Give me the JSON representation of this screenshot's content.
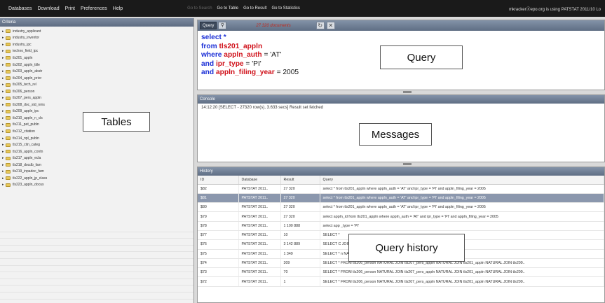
{
  "menu": {
    "left": [
      "Databases",
      "Download",
      "Print",
      "Preferences",
      "Help"
    ],
    "middle": [
      {
        "label": "Go to Search",
        "dim": true
      },
      {
        "label": "Go to Table",
        "dim": false
      },
      {
        "label": "Go to Result",
        "dim": false
      },
      {
        "label": "Go to Statistics",
        "dim": false
      }
    ],
    "user_status": "mkrackerⓐepo.org  is using  PATSTAT 2011/10  Lo"
  },
  "criteria": {
    "title": "Criteria",
    "tables": [
      "industry_applicant",
      "industry_inventor",
      "industry_ipc",
      "techno_field_ipc",
      "tls201_appln",
      "tls202_appln_title",
      "tls203_appln_abstr",
      "tls204_appln_prior",
      "tls205_tech_rel",
      "tls206_person",
      "tls207_pers_appln",
      "tls208_doc_std_nms",
      "tls209_appln_ipc",
      "tls210_appln_n_cls",
      "tls211_pat_publn",
      "tls212_citation",
      "tls214_npl_publn",
      "tls215_citn_categ",
      "tls216_appln_contn",
      "tls217_appln_ecla",
      "tls218_docdb_fam",
      "tls219_inpadoc_fam",
      "tls222_appln_jp_class",
      "tls223_appln_docus"
    ]
  },
  "query": {
    "button_label": "Query",
    "doc_count": "27 320 documents",
    "sql": {
      "l1_kw": "select *",
      "l2_kw": "from ",
      "l2_id": "tls201_appln",
      "l3_kw": "where ",
      "l3_id": "appln_auth",
      "l3_val": " = 'AT'",
      "l4_kw": "and ",
      "l4_id": "ipr_type",
      "l4_val": " = 'PI'",
      "l5_kw": "and ",
      "l5_id": "appln_filing_year",
      "l5_val": " = 2005"
    }
  },
  "console": {
    "title": "Console",
    "line": "14:12:20 [SELECT - 27320 row(s), 3.633 secs] Result set fetched"
  },
  "history": {
    "title": "History",
    "columns": [
      "ID",
      "Database",
      "Result",
      "Query"
    ],
    "rows": [
      {
        "id": "$82",
        "db": "PATSTAT 2011..",
        "result": "27 320",
        "query": "select * from tls201_appln where appln_auth = 'AT' and ipr_type = 'PI' and appln_filing_year = 2005",
        "selected": false
      },
      {
        "id": "$81",
        "db": "PATSTAT 2011..",
        "result": "27 320",
        "query": "select * from tls201_appln where appln_auth = 'AT' and ipr_type = 'PI' and appln_filing_year = 2005",
        "selected": true
      },
      {
        "id": "$80",
        "db": "PATSTAT 2011..",
        "result": "27 320",
        "query": "select * from tls201_appln where appln_auth = 'AT' and ipr_type = 'PI' and appln_filing_year = 2005",
        "selected": false
      },
      {
        "id": "$79",
        "db": "PATSTAT 2011..",
        "result": "27 320",
        "query": "select appln_id from tls201_appln where appln_auth = 'AT' and ipr_type = 'PI' and appln_filing_year = 2005",
        "selected": false
      },
      {
        "id": "$78",
        "db": "PATSTAT 2011..",
        "result": "1 100 888",
        "query": "select app                                              _type = 'PI'",
        "selected": false
      },
      {
        "id": "$77",
        "db": "PATSTAT 2011..",
        "result": "10",
        "query": "SELECT *",
        "selected": false
      },
      {
        "id": "$76",
        "db": "PATSTAT 2011..",
        "result": "3 142 889",
        "query": "SELECT C                                              JOIN tls206_person WHERE person_ctry_code = 'JP';",
        "selected": false
      },
      {
        "id": "$75",
        "db": "PATSTAT 2011..",
        "result": "1 349",
        "query": "SELECT *                                              n NATURAL JOIN tls201_appln NATURAL JOIN tls209..",
        "selected": false
      },
      {
        "id": "$74",
        "db": "PATSTAT 2011..",
        "result": "309",
        "query": "SELECT * FROM tls206_person NATURAL JOIN tls207_pers_appln NATURAL JOIN tls201_appln NATURAL JOIN tls209..",
        "selected": false
      },
      {
        "id": "$73",
        "db": "PATSTAT 2011..",
        "result": "70",
        "query": "SELECT * FROM tls206_person NATURAL JOIN tls207_pers_appln NATURAL JOIN tls201_appln NATURAL JOIN tls209..",
        "selected": false
      },
      {
        "id": "$72",
        "db": "PATSTAT 2011..",
        "result": "1",
        "query": "SELECT * FROM tls206_person NATURAL JOIN tls207_pers_appln NATURAL JOIN tls201_appln NATURAL JOIN tls209..",
        "selected": false
      }
    ]
  },
  "annotations": {
    "tables": "Tables",
    "query": "Query",
    "messages": "Messages",
    "query_history": "Query history"
  }
}
